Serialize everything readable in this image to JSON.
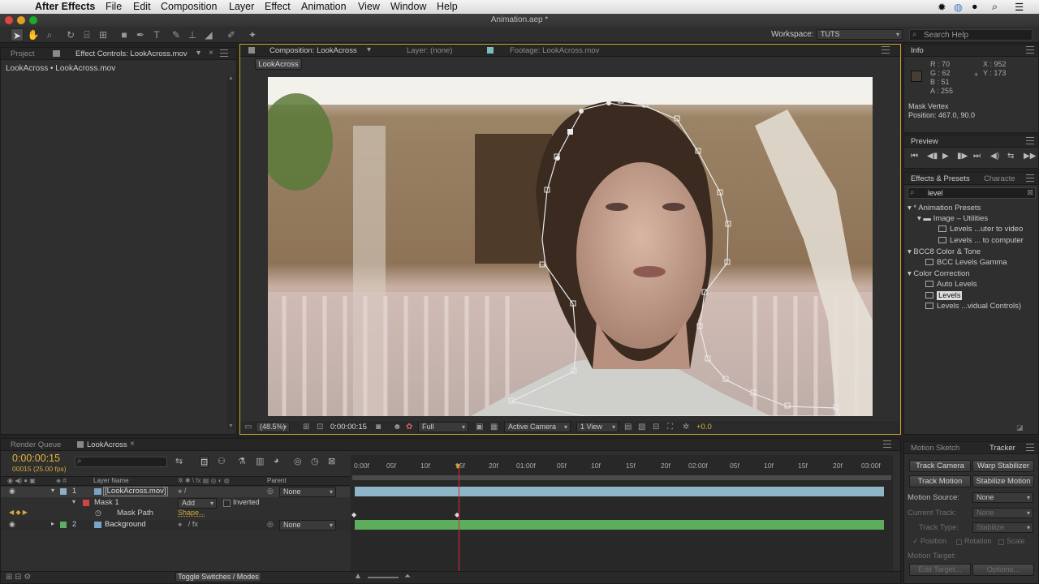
{
  "menubar": {
    "app_name": "After Effects",
    "menus": [
      "File",
      "Edit",
      "Composition",
      "Layer",
      "Effect",
      "Animation",
      "View",
      "Window",
      "Help"
    ]
  },
  "window": {
    "title": "Animation.aep *"
  },
  "toolbar": {
    "workspace_label": "Workspace:",
    "workspace_value": "TUTS",
    "search_placeholder": "Search Help"
  },
  "project_panel": {
    "tab_project": "Project",
    "tab_effect_controls": "Effect Controls: LookAcross.mov",
    "breadcrumb": "LookAcross • LookAcross.mov"
  },
  "comp_viewer": {
    "tab_composition": "Composition: LookAcross",
    "tab_layer": "Layer: (none)",
    "tab_footage": "Footage: LookAcross.mov",
    "comp_button": "LookAcross",
    "zoom": "(48.5%)",
    "timecode": "0:00:00:15",
    "resolution": "Full",
    "camera": "Active Camera",
    "view": "1 View",
    "exposure": "+0.0"
  },
  "info_panel": {
    "tab": "Info",
    "r": "R : 70",
    "g": "G : 62",
    "b": "B : 51",
    "a": "A : 255",
    "x": "X : 952",
    "y": "Y : 173",
    "plus": "+",
    "line1": "Mask Vertex",
    "line2": "Position: 467.0, 90.0",
    "swatch_color": "#463e33"
  },
  "preview_panel": {
    "tab": "Preview"
  },
  "effects_panel": {
    "tab": "Effects & Presets",
    "tab2": "Characte",
    "search_value": "level",
    "tree": [
      {
        "label": "* Animation Presets",
        "level": 0,
        "kind": "folder"
      },
      {
        "label": "Image – Utilities",
        "level": 1,
        "kind": "folder"
      },
      {
        "label": "Levels ...uter to video",
        "level": 2,
        "kind": "preset"
      },
      {
        "label": "Levels ... to computer",
        "level": 2,
        "kind": "preset"
      },
      {
        "label": "BCC8 Color & Tone",
        "level": 0,
        "kind": "category"
      },
      {
        "label": "BCC Levels Gamma",
        "level": 1,
        "kind": "effect"
      },
      {
        "label": "Color Correction",
        "level": 0,
        "kind": "category"
      },
      {
        "label": "Auto Levels",
        "level": 1,
        "kind": "effect"
      },
      {
        "label": "Levels",
        "level": 1,
        "kind": "effect",
        "selected": true
      },
      {
        "label": "Levels ...vidual Controls)",
        "level": 1,
        "kind": "effect"
      }
    ]
  },
  "timeline": {
    "tab_render_queue": "Render Queue",
    "tab_comp": "LookAcross",
    "timecode": "0:00:00:15",
    "frame_info": "00015 (25.00 fps)",
    "search_placeholder": "",
    "col_layer_name": "Layer Name",
    "col_parent": "Parent",
    "ruler_labels": [
      "0:00f",
      "05f",
      "10f",
      "15f",
      "20f",
      "01:00f",
      "05f",
      "10f",
      "15f",
      "20f",
      "02:00f",
      "05f",
      "10f",
      "15f",
      "20f",
      "03:00f"
    ],
    "layers": [
      {
        "num": "1",
        "name": "[LookAcross.mov]",
        "parent": "None",
        "color": "#8fb1c4"
      },
      {
        "num": "",
        "name": "Mask 1",
        "mode": "Add",
        "inverted_label": "Inverted",
        "color": "#c44"
      },
      {
        "num": "",
        "name": "Mask Path",
        "value": "Shape..."
      },
      {
        "num": "2",
        "name": "Background",
        "parent": "None",
        "color": "#5cae5c"
      }
    ],
    "toggle_label": "Toggle Switches / Modes"
  },
  "tracker_panel": {
    "tab_motion_sketch": "Motion Sketch",
    "tab_tracker": "Tracker",
    "btn_track_camera": "Track Camera",
    "btn_warp_stabilizer": "Warp Stabilizer",
    "btn_track_motion": "Track Motion",
    "btn_stabilize_motion": "Stabilize Motion",
    "motion_source_label": "Motion Source:",
    "motion_source_value": "None",
    "current_track_label": "Current Track:",
    "current_track_value": "None",
    "track_type_label": "Track Type:",
    "track_type_value": "Stabilize",
    "position_label": "Position",
    "rotation_label": "Rotation",
    "scale_label": "Scale",
    "motion_target_label": "Motion Target:",
    "edit_target_label": "Edit Target...",
    "options_label": "Options..."
  }
}
